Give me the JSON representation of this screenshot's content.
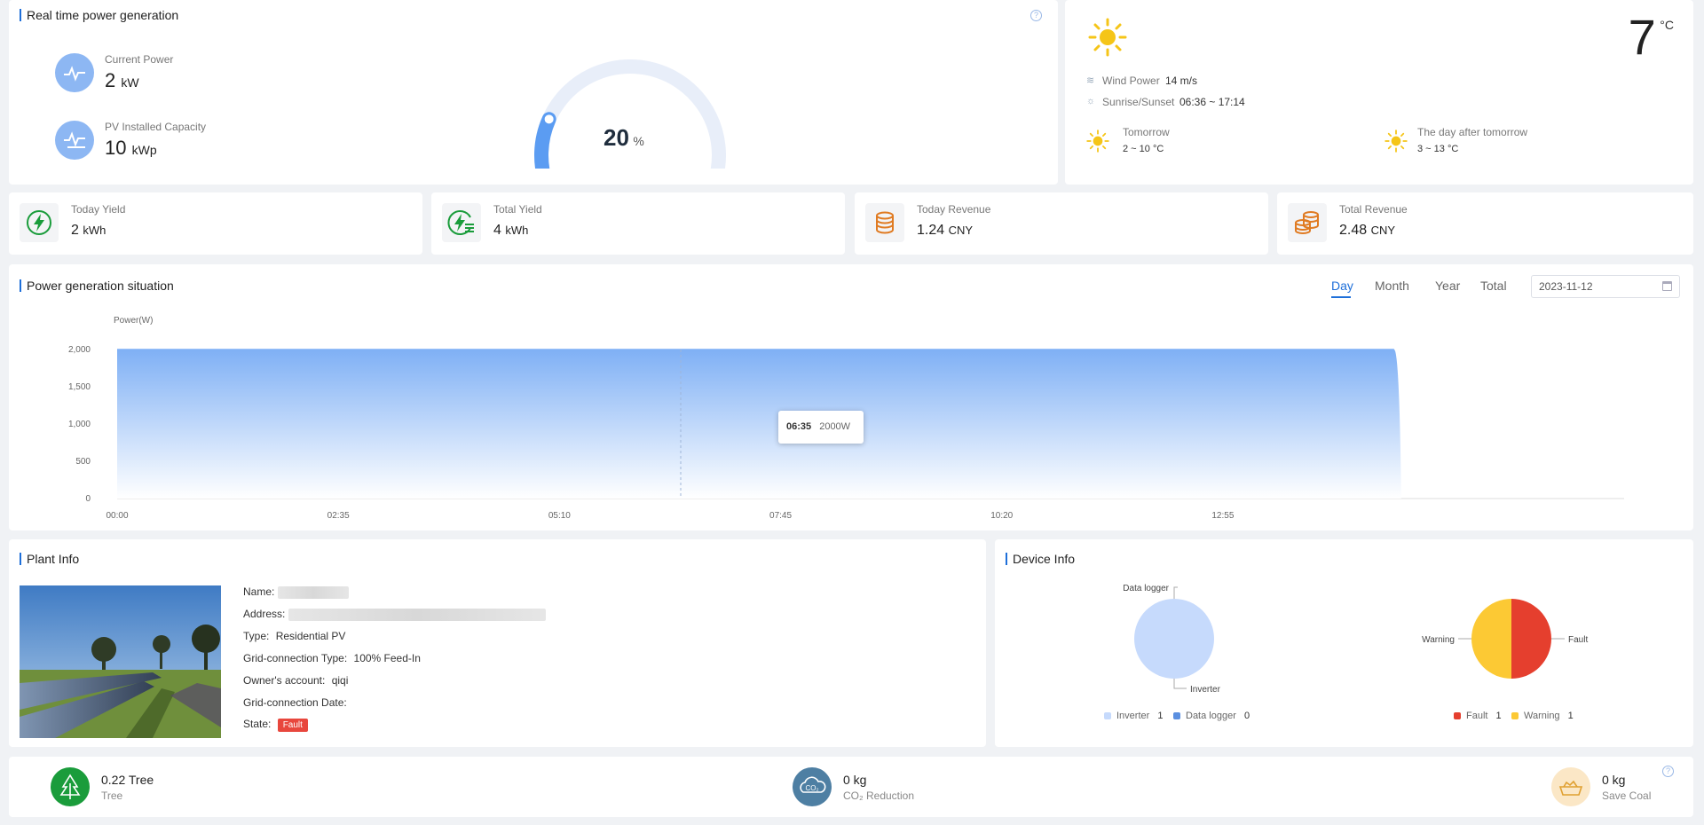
{
  "realtime": {
    "title": "Real time power generation",
    "current_power_label": "Current Power",
    "current_power_value": "2",
    "current_power_unit": "kW",
    "capacity_label": "PV Installed Capacity",
    "capacity_value": "10",
    "capacity_unit": "kWp",
    "gauge_value": "20",
    "gauge_unit": "%",
    "gauge_fraction": 0.2
  },
  "weather": {
    "temperature": "7",
    "temp_unit": "°C",
    "wind_label": "Wind Power",
    "wind_value": "14 m/s",
    "sun_label": "Sunrise/Sunset",
    "sun_value": "06:36 ~ 17:14",
    "tomorrow_label": "Tomorrow",
    "tomorrow_value": "2 ~ 10 °C",
    "after_label": "The day after tomorrow",
    "after_value": "3 ~ 13 °C",
    "sun_color": "#f5c518"
  },
  "stats": [
    {
      "label": "Today Yield",
      "value": "2",
      "unit": "kWh"
    },
    {
      "label": "Total Yield",
      "value": "4",
      "unit": "kWh"
    },
    {
      "label": "Today Revenue",
      "value": "1.24",
      "unit": "CNY"
    },
    {
      "label": "Total Revenue",
      "value": "2.48",
      "unit": "CNY"
    }
  ],
  "generation": {
    "title": "Power generation situation",
    "tabs": [
      "Day",
      "Month",
      "Year",
      "Total"
    ],
    "active_tab": "Day",
    "date": "2023-11-12",
    "tooltip_time": "06:35",
    "tooltip_value": "2000W"
  },
  "chart_data": {
    "type": "area",
    "ylabel": "Power(W)",
    "ylim": [
      0,
      2000
    ],
    "yticks": [
      0,
      500,
      1000,
      1500,
      2000
    ],
    "yticklabels": [
      "0",
      "500",
      "1,000",
      "1,500",
      "2,000"
    ],
    "xticklabels": [
      "00:00",
      "02:35",
      "05:10",
      "07:45",
      "10:20",
      "12:55"
    ],
    "series": [
      {
        "x": [
          "00:00",
          "14:55"
        ],
        "values": [
          2000,
          2000
        ]
      }
    ],
    "grid": false,
    "color": "#7fb0f5"
  },
  "plant": {
    "title": "Plant Info",
    "name_label": "Name:",
    "address_label": "Address:",
    "type_label": "Type:",
    "type_value": "Residential PV",
    "grid_type_label": "Grid-connection Type:",
    "grid_type_value": "100% Feed-In",
    "owner_label": "Owner's account:",
    "owner_value": "qiqi",
    "grid_date_label": "Grid-connection Date:",
    "grid_date_value": "",
    "state_label": "State:",
    "state_value": "Fault"
  },
  "device": {
    "title": "Device Info",
    "pie1": {
      "labels": [
        "Data logger",
        "Inverter"
      ],
      "legend": [
        {
          "name": "Inverter",
          "count": "1",
          "color": "#c6dafc"
        },
        {
          "name": "Data logger",
          "count": "0",
          "color": "#5b8fe0"
        }
      ]
    },
    "pie2": {
      "labels": [
        "Warning",
        "Fault"
      ],
      "legend": [
        {
          "name": "Fault",
          "count": "1",
          "color": "#e53f2e"
        },
        {
          "name": "Warning",
          "count": "1",
          "color": "#fcc934"
        }
      ]
    }
  },
  "env": {
    "tree_value": "0.22 Tree",
    "tree_label": "Tree",
    "co2_value": "0 kg",
    "co2_label": "CO₂ Reduction",
    "coal_value": "0 kg",
    "coal_label": "Save Coal"
  }
}
